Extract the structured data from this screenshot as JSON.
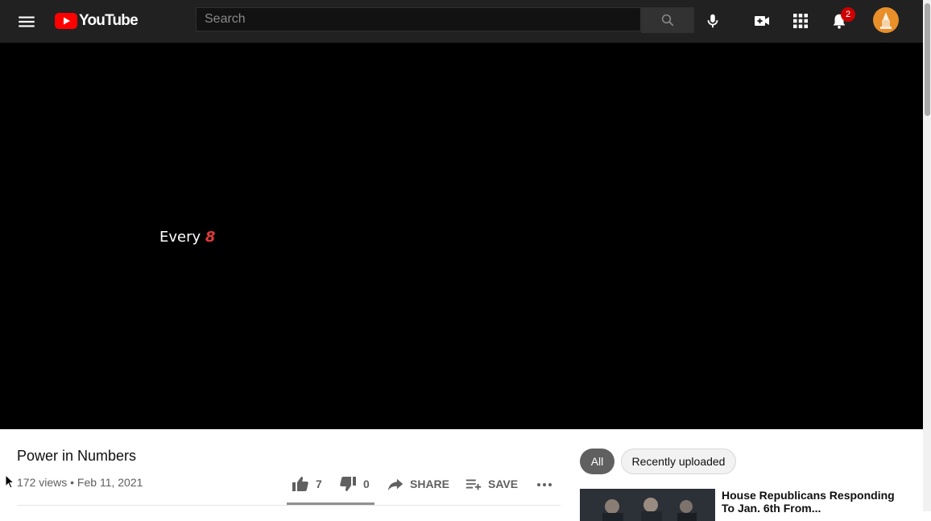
{
  "header": {
    "logo_text": "YouTube",
    "search_placeholder": "Search",
    "notification_count": "2",
    "icons": [
      "menu-icon",
      "search-icon",
      "microphone-icon",
      "create-video-icon",
      "apps-grid-icon",
      "notifications-bell-icon",
      "avatar"
    ]
  },
  "player": {
    "caption_text": "Every ",
    "caption_number": "8"
  },
  "video": {
    "title": "Power in Numbers",
    "meta": "172 views • Feb 11, 2021",
    "likes": "7",
    "dislikes": "0",
    "share_label": "SHARE",
    "save_label": "SAVE",
    "like_ratio": 1.0
  },
  "sidebar": {
    "chips": [
      "All",
      "Recently uploaded"
    ],
    "recommendations": [
      {
        "title": "House Republicans Responding To Jan. 6th From..."
      }
    ]
  },
  "colors": {
    "header_bg": "#212121",
    "logo_red": "#ff0000",
    "badge": "#cc0000",
    "avatar": "#e88f2a",
    "caption_accent": "#e03a3a"
  }
}
